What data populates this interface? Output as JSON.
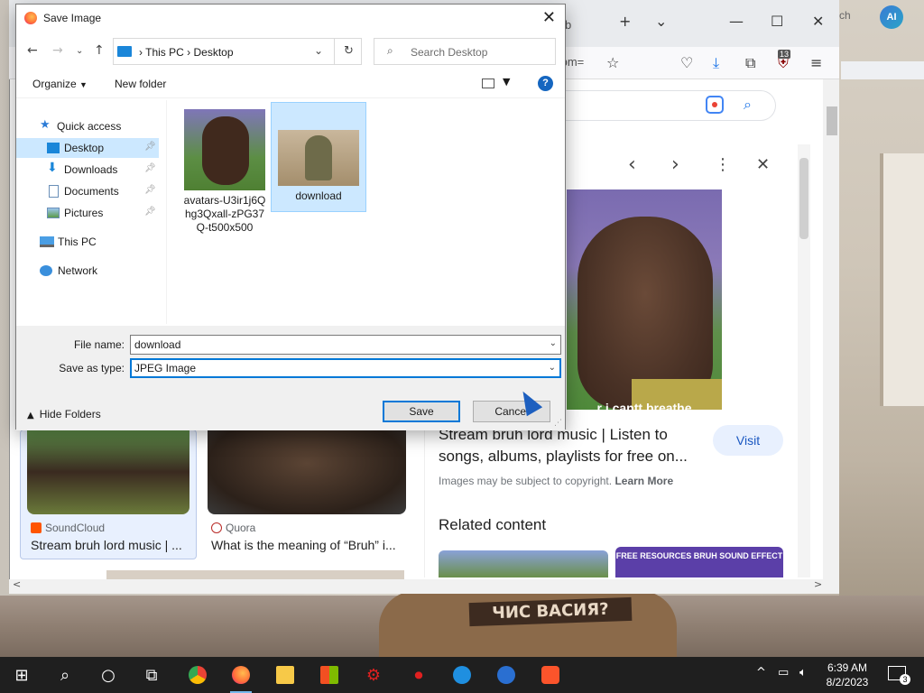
{
  "dialog": {
    "title": "Save Image",
    "address": {
      "segments": [
        "This PC",
        "Desktop"
      ],
      "separator": "›"
    },
    "search_placeholder": "Search Desktop",
    "toolbar": {
      "organize": "Organize",
      "new_folder": "New folder",
      "help": "?"
    },
    "nav_items": [
      {
        "label": "Quick access",
        "icon": "star-icon"
      },
      {
        "label": "Desktop",
        "icon": "desktop-icon",
        "selected": true,
        "pinned": true
      },
      {
        "label": "Downloads",
        "icon": "download-arrow-icon",
        "pinned": true
      },
      {
        "label": "Documents",
        "icon": "document-icon",
        "pinned": true
      },
      {
        "label": "Pictures",
        "icon": "pictures-icon",
        "pinned": true
      },
      {
        "label": "This PC",
        "icon": "computer-icon"
      },
      {
        "label": "Network",
        "icon": "network-icon"
      }
    ],
    "files": [
      {
        "name": "avatars-U3ir1j6Qhg3Qxall-zPG37Q-t500x500",
        "name_lines": [
          "avatars-U3ir1j6Q",
          "hg3Qxall-zPG37",
          "Q-t500x500"
        ]
      },
      {
        "name": "download",
        "selected": true
      }
    ],
    "file_name_label": "File name:",
    "file_name_value": "download",
    "save_as_type_label": "Save as type:",
    "save_as_type_value": "JPEG Image",
    "hide_folders": "Hide Folders",
    "save_button": "Save",
    "cancel_button": "Cancel"
  },
  "browser": {
    "url_fragment": "tbm=",
    "extension_badge": "13",
    "panel": {
      "image_caption": "r i cantt breathe",
      "title": "Stream bruh lord music | Listen to songs, albums, playlists for free on...",
      "visit": "Visit",
      "copyright_prefix": "Images may be subject to copyright.",
      "learn_more": "Learn More",
      "related": "Related content",
      "related_thumb_text": "FREE RESOURCES BRUH SOUND EFFECT"
    },
    "results": [
      {
        "source": "SoundCloud",
        "title": "Stream bruh lord music | ...",
        "source_color": "#ff5500"
      },
      {
        "source": "Quora",
        "title": "What is the meaning of “Bruh” i...",
        "source_color": "#b92b27"
      }
    ],
    "ai_button": "AI",
    "tab_fragment": "ch"
  },
  "wallpaper_text": "ЧИС ВАСИЯ?",
  "taskbar": {
    "time": "6:39 AM",
    "date": "8/2/2023",
    "notifications": "3"
  },
  "colors": {
    "accent": "#0078d7",
    "selection": "#cce8ff",
    "google_blue": "#1a73e8"
  }
}
